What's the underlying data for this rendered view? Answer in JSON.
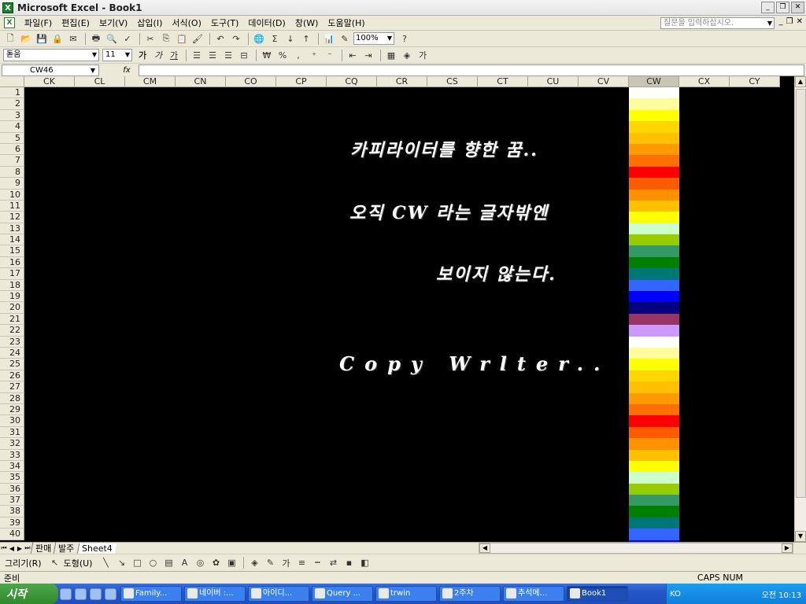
{
  "window": {
    "title": "Microsoft Excel - Book1",
    "app_icon_glyph": "X"
  },
  "menubar": {
    "items": [
      "파일(F)",
      "편집(E)",
      "보기(V)",
      "삽입(I)",
      "서식(O)",
      "도구(T)",
      "데이터(D)",
      "창(W)",
      "도움말(H)"
    ],
    "help_placeholder": "질문을 입력하십시오."
  },
  "toolbar": {
    "zoom": "100%",
    "font_name": "돋움",
    "font_size": "11"
  },
  "formula": {
    "name_box": "CW46",
    "fx": "fx",
    "value": ""
  },
  "grid": {
    "columns": [
      "CK",
      "CL",
      "CM",
      "CN",
      "CO",
      "CP",
      "CQ",
      "CR",
      "CS",
      "CT",
      "CU",
      "CV",
      "CW",
      "CX",
      "CY"
    ],
    "active_column": "CW",
    "rows": [
      "1",
      "2",
      "3",
      "4",
      "5",
      "6",
      "7",
      "8",
      "9",
      "10",
      "11",
      "12",
      "13",
      "14",
      "15",
      "16",
      "17",
      "18",
      "19",
      "20",
      "21",
      "22",
      "23",
      "24",
      "25",
      "26",
      "27",
      "28",
      "29",
      "30",
      "31",
      "32",
      "33",
      "34",
      "35",
      "36",
      "37",
      "38",
      "39",
      "40"
    ],
    "cw_colors": [
      "#ffffff",
      "#fffca0",
      "#ffff00",
      "#ffd700",
      "#ffc000",
      "#ff9a00",
      "#ff7000",
      "#ff0000",
      "#ff5a00",
      "#ff9000",
      "#ffc000",
      "#ffff00",
      "#ccffcc",
      "#99cc00",
      "#339966",
      "#008000",
      "#007777",
      "#3366ff",
      "#0000ff",
      "#000080",
      "#993366",
      "#cc99ff",
      "#ffffff",
      "#fffca0",
      "#ffff00",
      "#ffd700",
      "#ffc000",
      "#ff9a00",
      "#ff7000",
      "#ff0000",
      "#ff5a00",
      "#ff9000",
      "#ffc000",
      "#ffff00",
      "#ccffcc",
      "#99cc00",
      "#339966",
      "#008000",
      "#007777",
      "#3366ff",
      "#0000ff"
    ]
  },
  "content": {
    "line1": "카피라이터를 향한 꿈..",
    "line2": "오직 CW 라는 글자밖엔",
    "line3": "보이지 않는다.",
    "line4": "Copy Wrlter.."
  },
  "sheets": {
    "tabs": [
      "판매",
      "발주",
      "Sheet4"
    ],
    "active": "Sheet4"
  },
  "drawbar": {
    "draw_label": "그리기(R)",
    "shapes_label": "도형(U)"
  },
  "status": {
    "left": "준비",
    "caps": "CAPS NUM"
  },
  "taskbar": {
    "start_label": "시작",
    "buttons": [
      "Family...",
      "네이버 :...",
      "아이디...",
      "Query ...",
      "trwin",
      "2주차",
      "추석메...",
      "Book1"
    ],
    "active_button": "Book1",
    "tray_lang": "KO",
    "clock": "오전 10:13"
  },
  "colors": {
    "grid_bg": "#000000",
    "text": "#ffffff",
    "chrome": "#ece9d8",
    "taskbar": "#2456c7"
  }
}
